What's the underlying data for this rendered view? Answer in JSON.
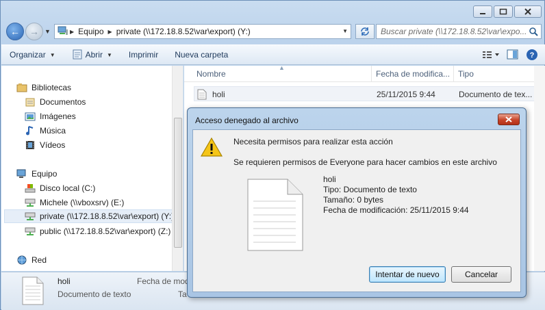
{
  "window": {
    "caption_buttons": [
      "minimize-icon",
      "maximize-icon",
      "close-icon"
    ]
  },
  "address": {
    "crumbs": [
      "Equipo",
      "private (\\\\172.18.8.52\\var\\export) (Y:)"
    ]
  },
  "search": {
    "placeholder": "Buscar private (\\\\172.18.8.52\\var\\expo..."
  },
  "toolbar": {
    "organize": "Organizar",
    "open": "Abrir",
    "print": "Imprimir",
    "new_folder": "Nueva carpeta"
  },
  "sidebar": {
    "libraries": "Bibliotecas",
    "documents": "Documentos",
    "images": "Imágenes",
    "music": "Música",
    "videos": "Vídeos",
    "computer": "Equipo",
    "local_disk": "Disco local (C:)",
    "michele": "Michele (\\\\vboxsrv) (E:)",
    "private": "private (\\\\172.18.8.52\\var\\export) (Y:)",
    "public": "public (\\\\172.18.8.52\\var\\export) (Z:)",
    "network": "Red"
  },
  "filelist": {
    "col_name": "Nombre",
    "col_date": "Fecha de modifica...",
    "col_type": "Tipo",
    "file_name": "holi",
    "file_date": "25/11/2015 9:44",
    "file_type": "Documento de tex..."
  },
  "details": {
    "name": "holi",
    "type": "Documento de texto",
    "date_label": "Fecha de modc",
    "size_label": "Ta"
  },
  "dialog": {
    "title": "Acceso denegado al archivo",
    "message": "Necesita permisos para realizar esta acción",
    "detail": "Se requieren permisos de Everyone para hacer cambios en este archivo",
    "file_name": "holi",
    "file_type": "Tipo: Documento de texto",
    "file_size": "Tamaño: 0 bytes",
    "file_date": "Fecha de modificación: 25/11/2015 9:44",
    "retry": "Intentar de nuevo",
    "cancel": "Cancelar"
  },
  "colors": {
    "accent": "#3c7fb1",
    "close_red": "#c8452a"
  }
}
